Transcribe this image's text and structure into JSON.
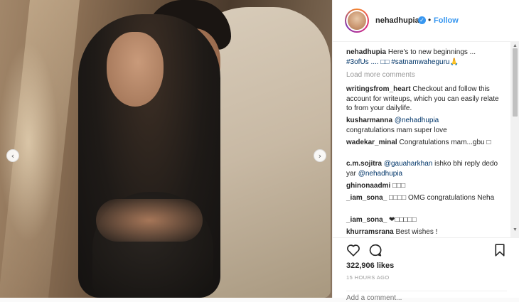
{
  "post": {
    "nav_prev_icon": "chevron-left-icon",
    "nav_next_icon": "chevron-right-icon",
    "nav_prev_glyph": "‹",
    "nav_next_glyph": "›"
  },
  "header": {
    "username": "nehadhupia",
    "verified_glyph": "✓",
    "separator": "•",
    "follow_label": "Follow"
  },
  "caption": {
    "username": "nehadhupia",
    "text": "Here's to new beginnings ...",
    "hashtags": "#3ofUs .... □□ #satnamwaheguru🙏"
  },
  "load_more_label": "Load more comments",
  "comments": [
    {
      "user": "writingsfrom_heart",
      "text": "Checkout and follow this account for writeups, which you can easily relate to from your dailylife."
    },
    {
      "user": "kusharmanna",
      "mention": "@nehadhupia",
      "text": "congratulations mam super love"
    },
    {
      "user": "wadekar_minal",
      "text": "Congratulations mam...gbu □"
    },
    {
      "user": "c.m.sojitra",
      "mention": "@gauaharkhan",
      "text": "ishko bhi reply dedo yar",
      "mention2": "@nehadhupia"
    },
    {
      "user": "ghinonaadmi",
      "text": "□□□"
    },
    {
      "user": "_iam_sona_",
      "text": "□□□□ OMG congratulations Neha"
    },
    {
      "user": "_iam_sona_",
      "text": "❤□□□□□"
    },
    {
      "user": "khurramsrana",
      "text": "Best wishes !"
    }
  ],
  "scrollbar": {
    "up_glyph": "▲",
    "down_glyph": "▼"
  },
  "likes": "322,906 likes",
  "timestamp": "15 HOURS AGO",
  "add_comment_placeholder": "Add a comment..."
}
